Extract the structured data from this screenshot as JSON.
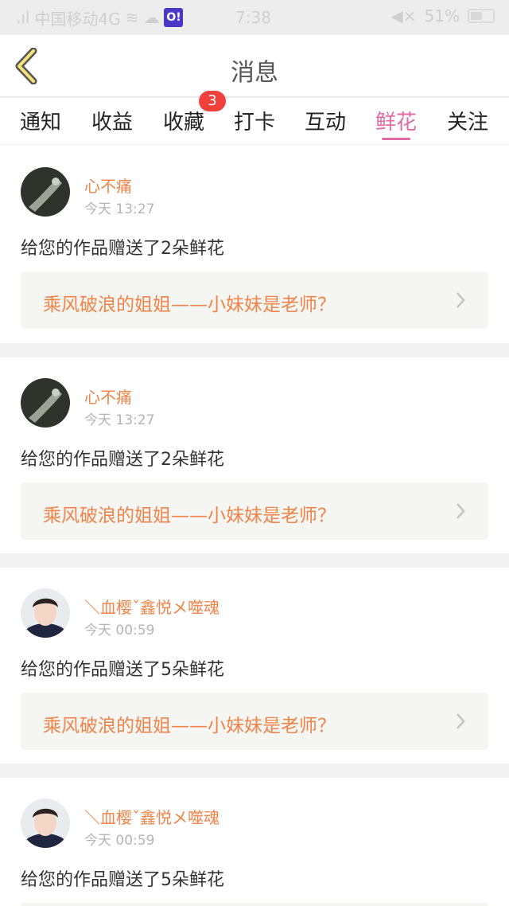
{
  "status_bar": {
    "carrier": "中国移动4G",
    "time": "7:38",
    "app_icon_text": "O!",
    "battery": "51%"
  },
  "header": {
    "title": "消息"
  },
  "tabs": [
    {
      "label": "通知"
    },
    {
      "label": "收益"
    },
    {
      "label": "收藏",
      "badge": "3"
    },
    {
      "label": "打卡"
    },
    {
      "label": "互动"
    },
    {
      "label": "鲜花",
      "active": true
    },
    {
      "label": "关注"
    }
  ],
  "colors": {
    "accent_pink": "#e06aa3",
    "name_orange": "#f0844a",
    "badge_red": "#f2413d"
  },
  "messages": [
    {
      "user": "心不痛",
      "time": "今天 13:27",
      "text": "给您的作品赠送了2朵鲜花",
      "work_title": "乘风破浪的姐姐——小妹妹是老师？"
    },
    {
      "user": "心不痛",
      "time": "今天 13:27",
      "text": "给您的作品赠送了2朵鲜花",
      "work_title": "乘风破浪的姐姐——小妹妹是老师？"
    },
    {
      "user": "＼血樱ˇ鑫悦メ噬魂",
      "time": "今天 00:59",
      "text": "给您的作品赠送了5朵鲜花",
      "work_title": "乘风破浪的姐姐——小妹妹是老师？"
    },
    {
      "user": "＼血樱ˇ鑫悦メ噬魂",
      "time": "今天 00:59",
      "text": "给您的作品赠送了5朵鲜花",
      "work_title": ""
    }
  ]
}
